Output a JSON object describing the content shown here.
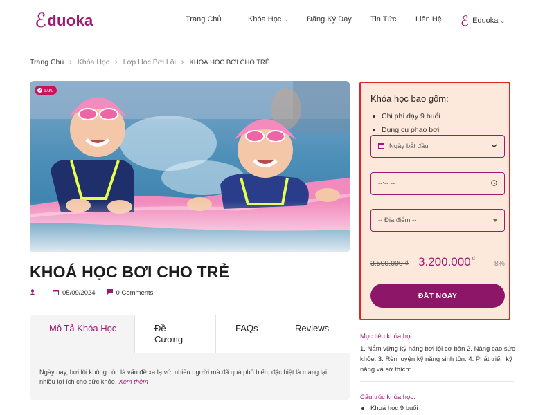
{
  "header": {
    "logo_mark": "ℰ",
    "logo_text": "duoka",
    "nav": [
      {
        "label": "Trang Chủ"
      },
      {
        "label": "Khóa Học"
      },
      {
        "label": "Đăng Ký Dạy"
      },
      {
        "label": "Tin Tức"
      },
      {
        "label": "Liên Hệ"
      }
    ],
    "brand_menu_label": "Eduoka",
    "caret": "⌄"
  },
  "breadcrumb": {
    "items": [
      "Trang Chủ",
      "Khóa Học",
      "Lớp Học Bơi Lội"
    ],
    "current": "KHOÁ HỌC BƠI CHO TRẺ",
    "separator": "›"
  },
  "hero": {
    "save_label": "Lưu"
  },
  "course": {
    "title": "KHOÁ HỌC BƠI CHO TRẺ",
    "date": "05/09/2024",
    "comments": "0 Comments"
  },
  "tabs": {
    "items": [
      {
        "label": "Mô Tả Khóa Học"
      },
      {
        "label": "Đề Cương"
      },
      {
        "label": "FAQs"
      },
      {
        "label": "Reviews"
      }
    ],
    "body": "Ngày nay, bơi lội không còn là vấn đề xa lạ với nhiều người mà đã quá phổ biến, đặc biệt là mang lại nhiều lợi ích cho sức khỏe.",
    "more": "Xem thêm"
  },
  "booking": {
    "heading": "Khóa học bao gồm:",
    "includes": [
      "Chi phí dạy 9 buổi",
      "Dụng cụ phao bơi"
    ],
    "start_date_label": "Ngày bắt đầu",
    "time_placeholder": "--:-- --",
    "location_placeholder": "-- Địa điểm --",
    "old_price": "3.500.000 ₫",
    "new_price": "3.200.000",
    "currency": "₫",
    "discount": "8%",
    "order_label": "ĐẶT NGAY"
  },
  "sidebar": {
    "goal_label": "Mục tiêu khóa học:",
    "goal_text": "1. Nắm vững kỹ năng bơi lội cơ bản 2. Nâng cao sức khỏe: 3. Rèn luyện kỹ năng sinh tồn: 4. Phát triển kỹ năng và sở thích:",
    "structure_label": "Cấu trúc khóa học:",
    "structure_items": [
      "Khoá học 9 buổi"
    ]
  },
  "colors": {
    "brand": "#9b1a72",
    "card_bg": "#fde9dc",
    "card_border": "#e02424"
  }
}
